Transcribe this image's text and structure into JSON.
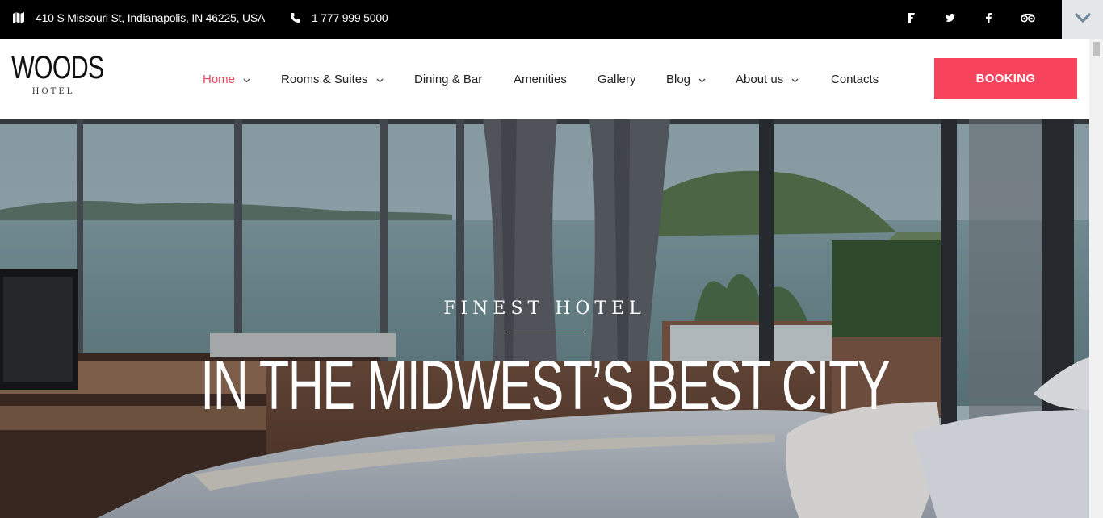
{
  "topbar": {
    "address": "410 S Missouri St, Indianapolis, IN 46225, USA",
    "phone": "1 777 999 5000",
    "address_icon": "map-icon",
    "phone_icon": "phone-icon",
    "social": [
      "foursquare-icon",
      "twitter-icon",
      "facebook-icon",
      "tripadvisor-icon"
    ]
  },
  "logo": {
    "main": "WOODS",
    "sub": "HOTEL"
  },
  "nav": {
    "items": [
      {
        "label": "Home",
        "active": true,
        "dropdown": true
      },
      {
        "label": "Rooms & Suites",
        "dropdown": true
      },
      {
        "label": "Dining & Bar",
        "dropdown": false
      },
      {
        "label": "Amenities",
        "dropdown": false
      },
      {
        "label": "Gallery",
        "dropdown": false
      },
      {
        "label": "Blog",
        "dropdown": true
      },
      {
        "label": "About us",
        "dropdown": true
      },
      {
        "label": "Contacts",
        "dropdown": false
      }
    ],
    "booking_label": "BOOKING"
  },
  "hero": {
    "eyebrow": "FINEST HOTEL",
    "title": "IN THE MIDWEST’S BEST CITY"
  },
  "colors": {
    "accent": "#f7435c",
    "topbar": "#000000",
    "active_nav": "#f0455e"
  }
}
